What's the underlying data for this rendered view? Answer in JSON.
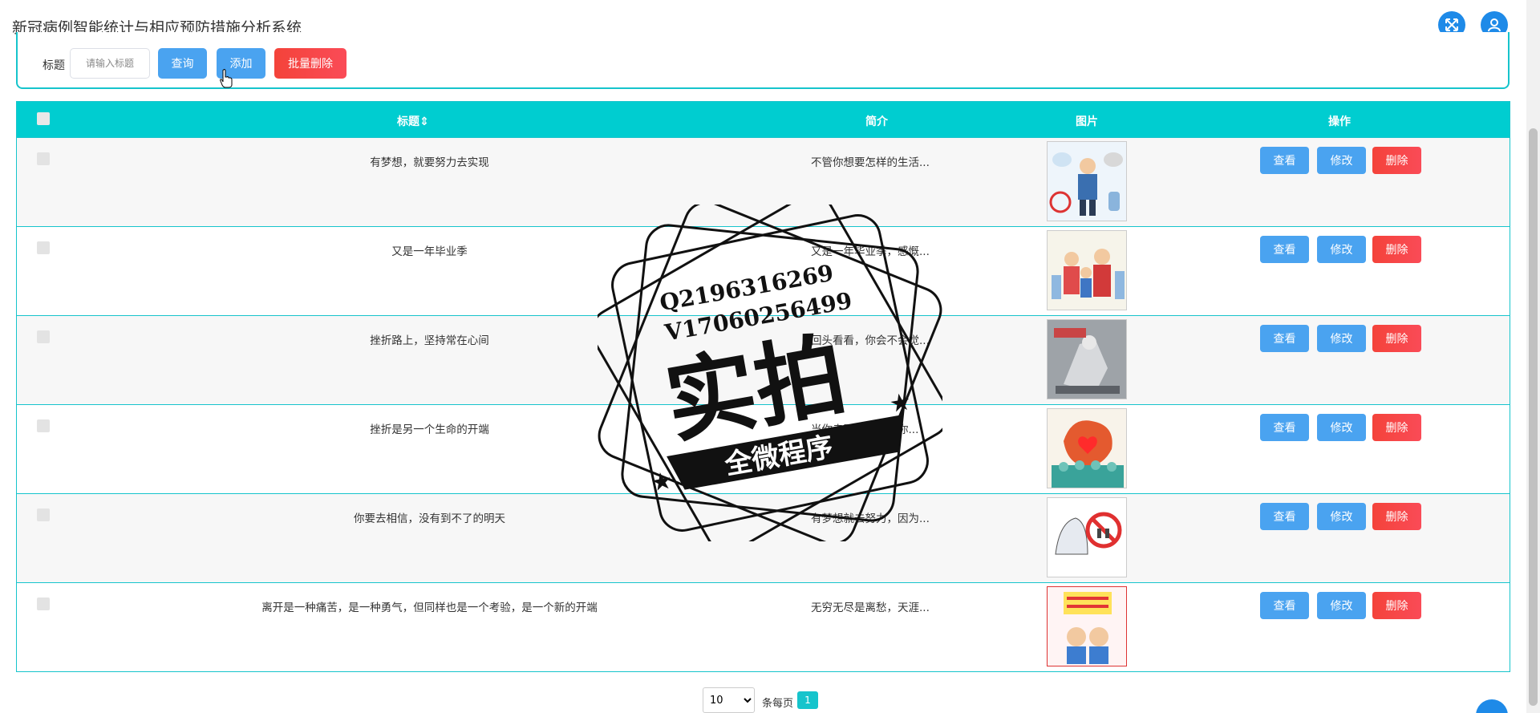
{
  "header": {
    "title": "新冠病例智能统计与相应预防措施分析系统",
    "fullscreen_icon": "expand-icon",
    "user_icon": "user-icon"
  },
  "search": {
    "label": "标题",
    "placeholder": "请输入标题",
    "query_label": "查询",
    "add_label": "添加",
    "batch_delete_label": "批量删除"
  },
  "table": {
    "headers": {
      "title": "标题",
      "intro": "简介",
      "image": "图片",
      "actions": "操作"
    },
    "rows": [
      {
        "title": "有梦想，就要努力去实现",
        "intro": "不管你想要怎样的生活..."
      },
      {
        "title": "又是一年毕业季",
        "intro": "又是一年毕业季，感慨..."
      },
      {
        "title": "挫折路上，坚持常在心间",
        "intro": "回头看看，你会不会觉..."
      },
      {
        "title": "挫折是另一个生命的开端",
        "intro": "当你走到了绝境，你..."
      },
      {
        "title": "你要去相信，没有到不了的明天",
        "intro": "有梦想就去努力，因为..."
      },
      {
        "title": "离开是一种痛苦，是一种勇气，但同样也是一个考验，是一个新的开端",
        "intro": "无穷无尽是离愁，天涯..."
      }
    ],
    "view_label": "查看",
    "edit_label": "修改",
    "delete_label": "删除"
  },
  "pagination": {
    "page_size": "10",
    "per_page_label": "条每页",
    "current_page": "1"
  },
  "watermark": {
    "line1": "Q2196316269",
    "line2": "V17060256499",
    "main": "实拍",
    "ribbon": "全微程序"
  },
  "colors": {
    "accent": "#00cdd0",
    "primary_button": "#4aa3f0",
    "danger_button": "#f4433a",
    "header_icon_bg": "#1e8ae8"
  }
}
